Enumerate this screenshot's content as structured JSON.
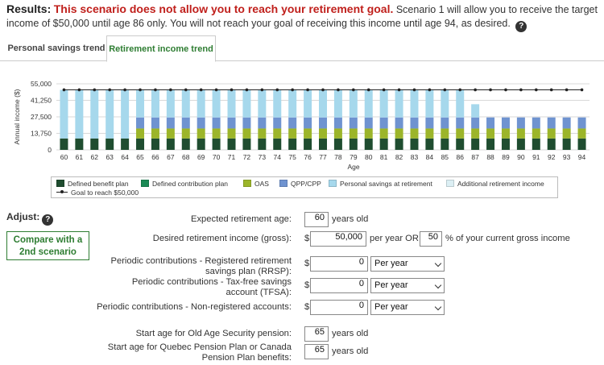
{
  "results": {
    "label": "Results:",
    "headline": "This scenario does not allow you to reach your retirement goal.",
    "detail": " Scenario 1 will allow you to receive the target income of $50,000 until age 86 only. You will not reach your goal of receiving this income until age 94, as desired."
  },
  "tabs": [
    {
      "label": "Personal savings trend",
      "active": false
    },
    {
      "label": "Retirement income trend",
      "active": true
    }
  ],
  "chart_data": {
    "type": "bar",
    "stacked": true,
    "ylabel": "Annual income ($)",
    "xlabel": "Age",
    "ylim": [
      0,
      55000
    ],
    "yticks": [
      "55,000",
      "41,250",
      "27,500",
      "13,750",
      "0"
    ],
    "ytick_values": [
      55000,
      41250,
      27500,
      13750,
      0
    ],
    "categories": [
      "60",
      "61",
      "62",
      "63",
      "64",
      "65",
      "66",
      "67",
      "68",
      "69",
      "70",
      "71",
      "72",
      "73",
      "74",
      "75",
      "76",
      "77",
      "78",
      "79",
      "80",
      "81",
      "82",
      "83",
      "84",
      "85",
      "86",
      "87",
      "88",
      "89",
      "90",
      "91",
      "92",
      "93",
      "94"
    ],
    "series": [
      {
        "name": "Defined benefit plan",
        "color": "#1f4d30",
        "values": [
          9500,
          9500,
          9500,
          9500,
          9500,
          9500,
          9500,
          9500,
          9500,
          9500,
          9500,
          9500,
          9500,
          9500,
          9500,
          9500,
          9500,
          9500,
          9500,
          9500,
          9500,
          9500,
          9500,
          9500,
          9500,
          9500,
          9500,
          9500,
          9500,
          9500,
          9500,
          9500,
          9500,
          9500,
          9500
        ]
      },
      {
        "name": "Defined contribution plan",
        "color": "#1a8a55",
        "values": [
          0,
          0,
          0,
          0,
          0,
          0,
          0,
          0,
          0,
          0,
          0,
          0,
          0,
          0,
          0,
          0,
          0,
          0,
          0,
          0,
          0,
          0,
          0,
          0,
          0,
          0,
          0,
          0,
          0,
          0,
          0,
          0,
          0,
          0,
          0
        ]
      },
      {
        "name": "OAS",
        "color": "#9cb52a",
        "values": [
          0,
          0,
          0,
          0,
          0,
          8300,
          8300,
          8300,
          8300,
          8300,
          8300,
          8300,
          8300,
          8300,
          8300,
          8300,
          8300,
          8300,
          8300,
          8300,
          8300,
          8300,
          8300,
          8300,
          8300,
          8300,
          8300,
          8300,
          8300,
          8300,
          8300,
          8300,
          8300,
          8300,
          8300
        ]
      },
      {
        "name": "QPP/CPP",
        "color": "#6f93d0",
        "values": [
          0,
          0,
          0,
          0,
          0,
          9200,
          9200,
          9200,
          9200,
          9200,
          9200,
          9200,
          9200,
          9200,
          9200,
          9200,
          9200,
          9200,
          9200,
          9200,
          9200,
          9200,
          9200,
          9200,
          9200,
          9200,
          9200,
          9200,
          9200,
          9200,
          9200,
          9200,
          9200,
          9200,
          9200
        ]
      },
      {
        "name": "Personal savings at retirement",
        "color": "#a6d8ec",
        "values": [
          40500,
          40500,
          40500,
          40500,
          40500,
          23000,
          23000,
          23000,
          23000,
          23000,
          23000,
          23000,
          23000,
          23000,
          23000,
          23000,
          23000,
          23000,
          23000,
          23000,
          23000,
          23000,
          23000,
          23000,
          23000,
          23000,
          23000,
          11000,
          0,
          0,
          0,
          0,
          0,
          0,
          0
        ]
      },
      {
        "name": "Additional retirement income",
        "color": "#dceff4",
        "values": [
          0,
          0,
          0,
          0,
          0,
          0,
          0,
          0,
          0,
          0,
          0,
          0,
          0,
          0,
          0,
          0,
          0,
          0,
          0,
          0,
          0,
          0,
          0,
          0,
          0,
          0,
          0,
          0,
          0,
          0,
          0,
          0,
          0,
          0,
          0
        ]
      }
    ],
    "goal": {
      "name": "Goal to reach $50,000",
      "color": "#222222",
      "value": 50000
    }
  },
  "legend": {
    "items": [
      {
        "label": "Defined benefit plan",
        "color": "#1f4d30"
      },
      {
        "label": "Defined contribution plan",
        "color": "#1a8a55"
      },
      {
        "label": "OAS",
        "color": "#9cb52a"
      },
      {
        "label": "QPP/CPP",
        "color": "#6f93d0"
      },
      {
        "label": "Personal savings at retirement",
        "color": "#a6d8ec"
      },
      {
        "label": "Additional retirement income",
        "color": "#dceff4"
      }
    ],
    "goal_label": "Goal to reach $50,000"
  },
  "adjust": {
    "label": "Adjust:",
    "compare_button": "Compare with a 2nd scenario"
  },
  "form": {
    "retirement_age_label": "Expected retirement age:",
    "retirement_age": "60",
    "years_old": "years old",
    "desired_income_label": "Desired retirement income (gross):",
    "dollar": "$",
    "desired_income": "50,000",
    "per_year_or": "per year OR",
    "percent": "50",
    "percent_suffix": "% of your current gross income",
    "rrsp_label": "Periodic contributions - Registered retirement savings plan (RRSP):",
    "rrsp_value": "0",
    "tfsa_label": "Periodic contributions - Tax-free savings account (TFSA):",
    "tfsa_value": "0",
    "nonreg_label": "Periodic contributions - Non-registered accounts:",
    "nonreg_value": "0",
    "frequency": "Per year",
    "oas_age_label": "Start age for Old Age Security pension:",
    "oas_age": "65",
    "qpp_age_label": "Start age for Quebec Pension Plan or Canada Pension Plan benefits:",
    "qpp_age": "65"
  }
}
